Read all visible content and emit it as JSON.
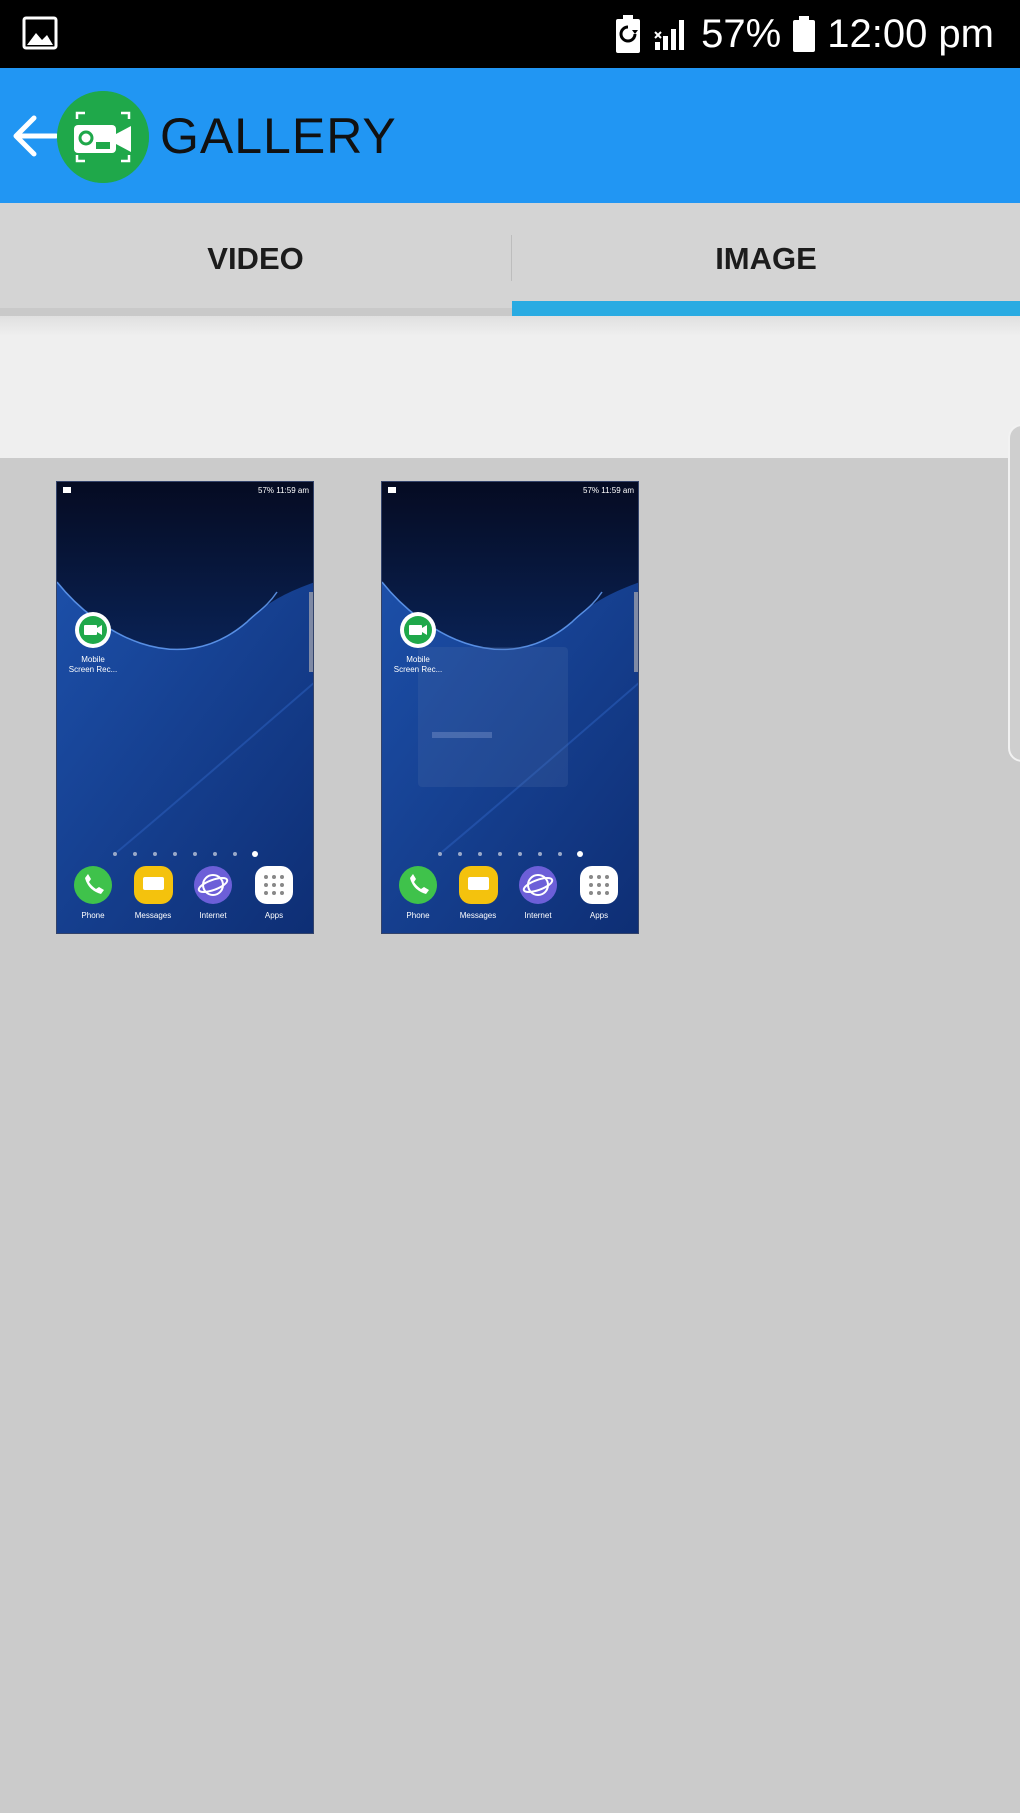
{
  "status_bar": {
    "left_icon": "image-notification-icon",
    "battery_saver_icon": "battery-saver-icon",
    "signal_icon": "signal-icon",
    "battery_percent": "57%",
    "battery_icon": "battery-icon",
    "time": "12:00 pm"
  },
  "app_bar": {
    "back_icon": "arrow-left-icon",
    "logo_icon": "screen-recorder-logo-icon",
    "title": "GALLERY"
  },
  "tabs": [
    {
      "label": "VIDEO",
      "selected": false
    },
    {
      "label": "IMAGE",
      "selected": true
    }
  ],
  "colors": {
    "app_bar": "#2196f3",
    "tab_indicator": "#29abe2",
    "logo_green": "#1fa84a",
    "background": "#cbcbcb"
  },
  "thumbnails": [
    {
      "status_text": "57% 11:59 am",
      "app_shortcut_label_1": "Mobile",
      "app_shortcut_label_2": "Screen Rec...",
      "dock": [
        "Phone",
        "Messages",
        "Internet",
        "Apps"
      ]
    },
    {
      "status_text": "57% 11:59 am",
      "app_shortcut_label_1": "Mobile",
      "app_shortcut_label_2": "Screen Rec...",
      "dock": [
        "Phone",
        "Messages",
        "Internet",
        "Apps"
      ]
    }
  ]
}
